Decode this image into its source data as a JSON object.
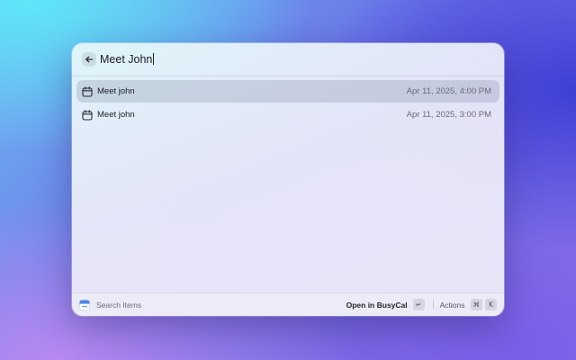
{
  "search": {
    "query": "Meet John"
  },
  "results": [
    {
      "title": "Meet john",
      "date": "Apr 11, 2025, 4:00 PM",
      "icon": "calendar-icon",
      "selected": true
    },
    {
      "title": "Meet john",
      "date": "Apr 11, 2025, 3:00 PM",
      "icon": "calendar-icon",
      "selected": false
    }
  ],
  "footer": {
    "status": "Search Items",
    "app_icon": "busycal-app-icon",
    "primary_action": "Open in BusyCal",
    "primary_key": "↵",
    "actions_label": "Actions",
    "actions_keys": [
      "⌘",
      "K"
    ]
  },
  "colors": {
    "selection": "#c9cbd8",
    "accent_blue": "#3d7be0"
  }
}
